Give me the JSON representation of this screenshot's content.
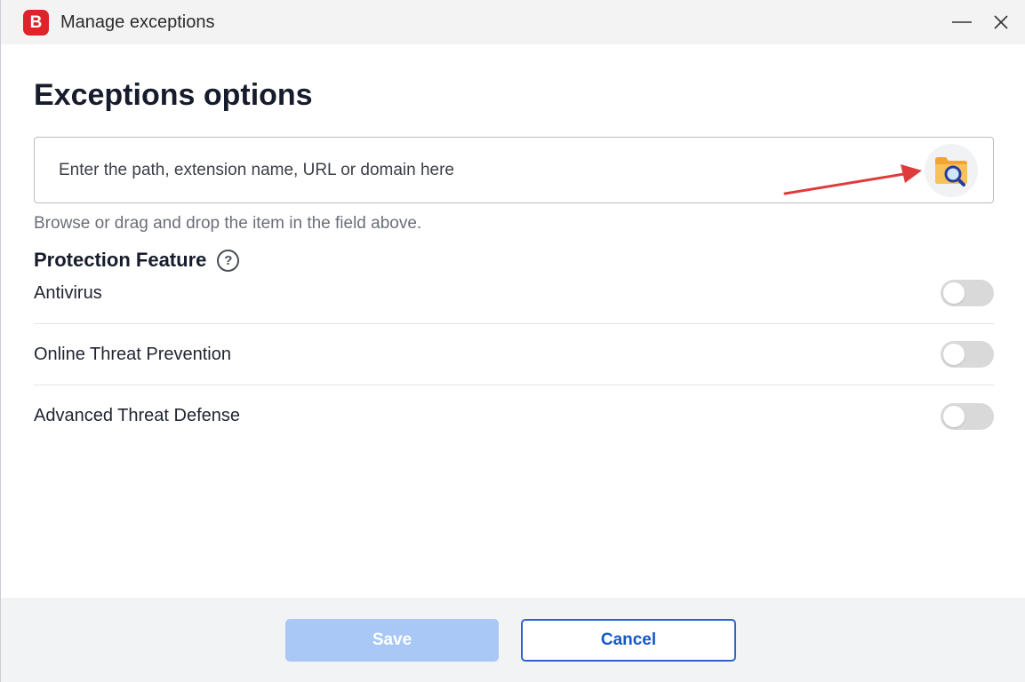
{
  "window": {
    "title": "Manage exceptions",
    "logo_letter": "B"
  },
  "main": {
    "page_title": "Exceptions options",
    "path_input": {
      "value": "",
      "placeholder": "Enter the path, extension name, URL or domain here"
    },
    "browse_icon": "folder-search-icon",
    "hint": "Browse or drag and drop the item in the field above.",
    "protection_heading": "Protection Feature",
    "help_glyph": "?",
    "features": [
      {
        "label": "Antivirus",
        "enabled": false
      },
      {
        "label": "Online Threat Prevention",
        "enabled": false
      },
      {
        "label": "Advanced Threat Defense",
        "enabled": false
      }
    ]
  },
  "footer": {
    "save_label": "Save",
    "cancel_label": "Cancel"
  },
  "colors": {
    "brand": "#e0222a",
    "primary": "#1459c8",
    "primary_disabled": "#a9c8f6",
    "annotation_arrow": "#e03b3b"
  }
}
